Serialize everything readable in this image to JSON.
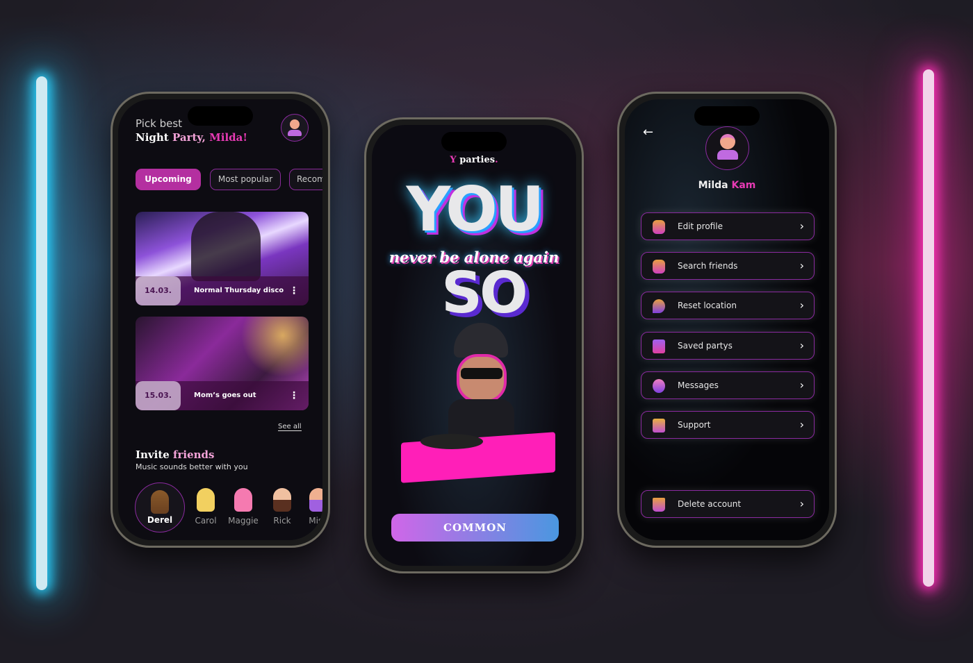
{
  "colors": {
    "accent": "#e83bb5",
    "tab_active": "#b42fa0",
    "border": "#8b2aa0",
    "button_gradient": [
      "#d066e8",
      "#4a97e0"
    ]
  },
  "home": {
    "greeting": "Pick best",
    "title_part1": "Night",
    "title_part2": "Party,",
    "title_part3": "Milda!",
    "tabs": [
      {
        "label": "Upcoming",
        "active": true
      },
      {
        "label": "Most popular",
        "active": false
      },
      {
        "label": "Recom",
        "active": false
      }
    ],
    "events": [
      {
        "date": "14.03.",
        "title": "Normal Thursday disco"
      },
      {
        "date": "15.03.",
        "title": "Mom’s goes out"
      }
    ],
    "see_all": "See all",
    "invite_title_part1": "Invite",
    "invite_title_part2": "friends",
    "invite_subtitle": "Music sounds better with you",
    "friends": [
      {
        "name": "Derel",
        "selected": true
      },
      {
        "name": "Carol"
      },
      {
        "name": "Maggie"
      },
      {
        "name": "Rick"
      },
      {
        "name": "Mish"
      }
    ]
  },
  "splash": {
    "logo": "parties",
    "headline_top": "YOU",
    "tagline": "never be alone again",
    "headline_bottom": "SO",
    "button": "COMMON"
  },
  "profile": {
    "name_first": "Milda",
    "name_last": "Kam",
    "menu": [
      {
        "label": "Edit profile",
        "icon": "edit-profile-icon"
      },
      {
        "label": "Search friends",
        "icon": "friends-icon"
      },
      {
        "label": "Reset location",
        "icon": "location-pin-icon"
      },
      {
        "label": "Saved partys",
        "icon": "bookmark-icon"
      },
      {
        "label": "Messages",
        "icon": "chat-bubble-icon"
      },
      {
        "label": "Support",
        "icon": "folder-icon"
      }
    ],
    "delete": "Delete account"
  }
}
